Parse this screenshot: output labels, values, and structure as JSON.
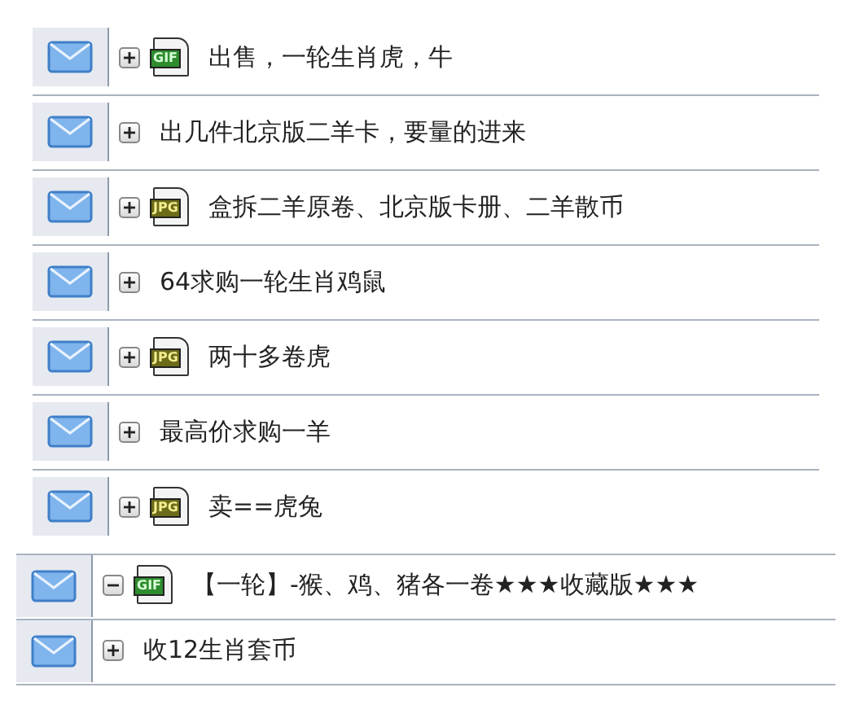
{
  "groups": [
    {
      "rows": [
        {
          "title": "出售，一轮生肖虎，牛",
          "expanded": false,
          "attachment": {
            "kind": "gif",
            "label": "GIF"
          }
        },
        {
          "title": "出几件北京版二羊卡，要量的进来",
          "expanded": false
        },
        {
          "title": "盒拆二羊原卷、北京版卡册、二羊散币",
          "expanded": false,
          "attachment": {
            "kind": "jpg",
            "label": "JPG"
          }
        },
        {
          "title": "64求购一轮生肖鸡鼠",
          "expanded": false
        },
        {
          "title": "两十多卷虎",
          "expanded": false,
          "attachment": {
            "kind": "jpg",
            "label": "JPG"
          }
        },
        {
          "title": "最高价求购一羊",
          "expanded": false
        },
        {
          "title": "卖==虎兔",
          "expanded": false,
          "attachment": {
            "kind": "jpg",
            "label": "JPG"
          }
        }
      ]
    },
    {
      "rows": [
        {
          "title": "【一轮】-猴、鸡、猪各一卷★★★收藏版★★★",
          "expanded": true,
          "attachment": {
            "kind": "gif",
            "label": "GIF"
          }
        },
        {
          "title": "收12生肖套币",
          "expanded": false
        }
      ]
    }
  ]
}
